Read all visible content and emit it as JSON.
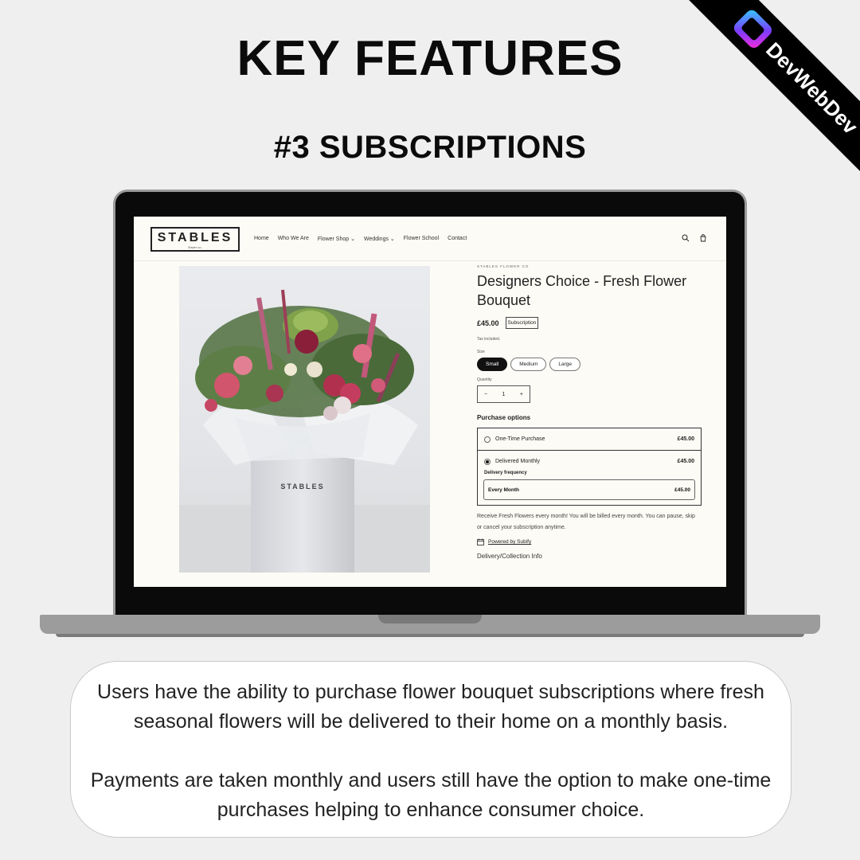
{
  "heading": {
    "title": "KEY FEATURES",
    "subtitle": "#3 SUBSCRIPTIONS"
  },
  "ribbon": {
    "brand": "DevWebDev",
    "logo_icon": "devwebdev-logo-icon"
  },
  "site": {
    "brand_name": "STABLES",
    "brand_tagline": "flower co.",
    "nav": [
      "Home",
      "Who We Are",
      "Flower Shop ⌄",
      "Weddings ⌄",
      "Flower School",
      "Contact"
    ],
    "search_icon": "search-icon",
    "cart_icon": "cart-icon"
  },
  "product": {
    "vendor": "STABLES FLOWER CO",
    "title": "Designers Choice - Fresh Flower Bouquet",
    "price": "£45.00",
    "badge": "Subscription",
    "tax_note": "Tax included.",
    "size_label": "Size",
    "sizes": [
      "Small",
      "Medium",
      "Large"
    ],
    "selected_size": "Small",
    "quantity_label": "Quantity",
    "quantity": "1",
    "qty_minus": "−",
    "qty_plus": "+",
    "purchase_options_title": "Purchase options",
    "options": [
      {
        "label": "One-Time Purchase",
        "price": "£45.00",
        "selected": false
      },
      {
        "label": "Delivered Monthly",
        "price": "£45.00",
        "selected": true
      }
    ],
    "frequency_label": "Delivery frequency",
    "frequency_value": "Every Month",
    "frequency_price": "£45.00",
    "description": "Receive Fresh Flowers every month! You will be billed every month. You can pause, skip or cancel your subscription anytime.",
    "powered_by": "Powered by Subify",
    "delivery_info": "Delivery/Collection Info",
    "box_label": "STABLES"
  },
  "card": {
    "paragraph1": "Users have the ability to purchase flower bouquet subscriptions where fresh seasonal flowers will be delivered to their home on a monthly basis.",
    "paragraph2": "Payments are taken monthly and users still have the option to make one-time purchases helping to enhance consumer choice."
  }
}
